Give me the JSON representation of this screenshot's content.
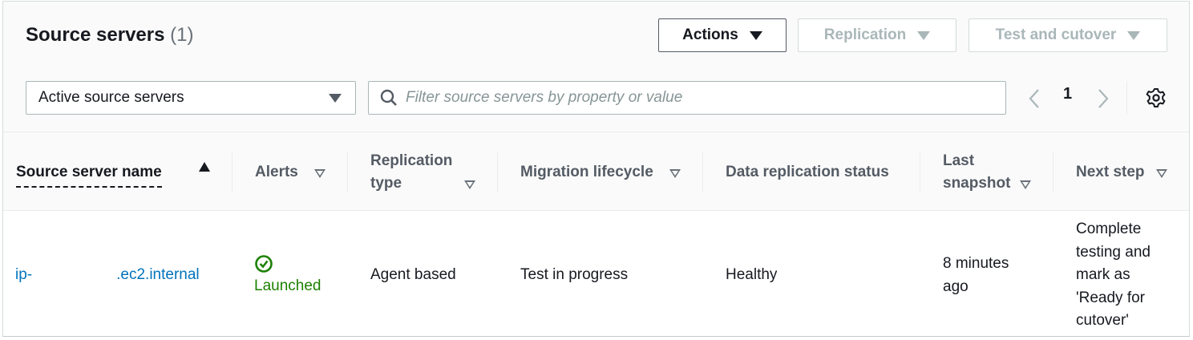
{
  "header": {
    "title": "Source servers",
    "count": "(1)"
  },
  "actions": {
    "actions_label": "Actions",
    "replication_label": "Replication",
    "test_cutover_label": "Test and cutover"
  },
  "filter": {
    "select_value": "Active source servers",
    "search_placeholder": "Filter source servers by property or value"
  },
  "pagination": {
    "current_page": "1"
  },
  "columns": {
    "name": "Source server name",
    "alerts": "Alerts",
    "replication_type_1": "Replication",
    "replication_type_2": "type",
    "lifecycle": "Migration lifecycle",
    "data_status": "Data replication status",
    "snapshot_1": "Last",
    "snapshot_2": "snapshot",
    "next_step": "Next step"
  },
  "rows": [
    {
      "name_prefix": "ip-",
      "name_suffix": ".ec2.internal",
      "alert": "Launched",
      "replication_type": "Agent based",
      "lifecycle": "Test in progress",
      "data_status": "Healthy",
      "snapshot_1": "8 minutes",
      "snapshot_2": "ago",
      "next_step": [
        "Complete",
        "testing and",
        "mark as",
        "'Ready for",
        "cutover'"
      ]
    }
  ],
  "colors": {
    "link": "#0073bb",
    "success": "#1d8102"
  }
}
